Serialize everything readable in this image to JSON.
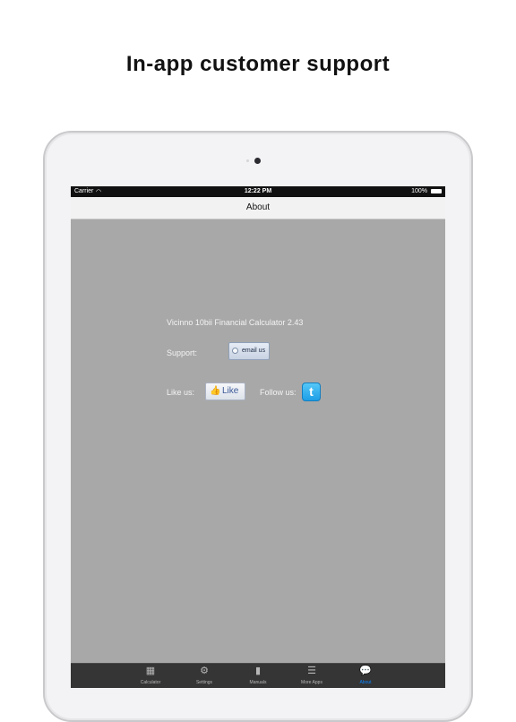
{
  "headline": "In-app customer support",
  "status_bar": {
    "carrier": "Carrier",
    "wifi_icon": "wifi-icon",
    "time": "12:22 PM",
    "battery": "100%"
  },
  "nav": {
    "title": "About"
  },
  "content": {
    "app_version": "Vicinno 10bii Financial Calculator 2.43",
    "support_label": "Support:",
    "email_button": "email us",
    "like_label": "Like us:",
    "like_button": "Like",
    "follow_label": "Follow us:"
  },
  "tabs": [
    {
      "label": "Calculator",
      "icon": "calculator-icon"
    },
    {
      "label": "Settings",
      "icon": "gear-icon"
    },
    {
      "label": "Manuals",
      "icon": "book-icon"
    },
    {
      "label": "More Apps",
      "icon": "stack-icon"
    },
    {
      "label": "About",
      "icon": "speech-bubble-icon",
      "active": true
    }
  ],
  "colors": {
    "content_background": "#a8a8a8",
    "tab_active": "#0a84ff",
    "tabbar_background": "#353535"
  }
}
